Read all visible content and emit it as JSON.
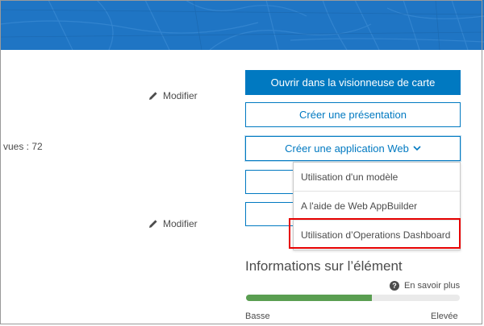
{
  "left": {
    "modify_label_1": "Modifier",
    "modify_label_2": "Modifier",
    "views_text": "vues : 72"
  },
  "actions": {
    "open_map_viewer": "Ouvrir dans la visionneuse de carte",
    "create_presentation": "Créer une présentation",
    "create_web_app": "Créer une application Web"
  },
  "dropdown": {
    "items": [
      "Utilisation d'un modèle",
      "A l'aide de Web AppBuilder",
      "Utilisation d’Operations Dashboard"
    ],
    "highlighted_index": 2
  },
  "item_info": {
    "title": "Informations sur l’élément",
    "learn_more": "En savoir plus",
    "low_label": "Basse",
    "high_label": "Elevée",
    "score_fraction": 0.59
  },
  "colors": {
    "banner": "#1f75c4",
    "primary": "#0079c1",
    "highlight_border": "#e60000",
    "progress_fill": "#5a9e51"
  }
}
